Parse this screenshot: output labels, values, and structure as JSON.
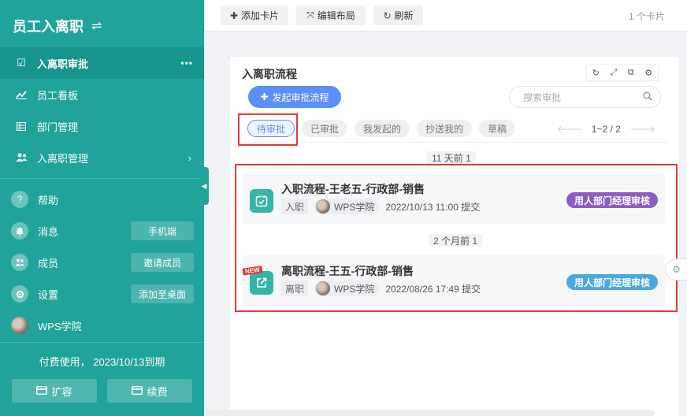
{
  "app": {
    "title": "员工入离职",
    "swap_icon": "swap-icon"
  },
  "sidebar": {
    "nav": [
      {
        "label": "入离职审批",
        "icon": "check-square-icon",
        "active": true,
        "more": "•••"
      },
      {
        "label": "员工看板",
        "icon": "line-chart-icon"
      },
      {
        "label": "部门管理",
        "icon": "table-icon"
      },
      {
        "label": "入离职管理",
        "icon": "users-icon",
        "chevron": "›"
      }
    ],
    "util": [
      {
        "label": "帮助",
        "icon": "question-icon"
      },
      {
        "label": "消息",
        "icon": "bell-icon",
        "action": "手机端"
      },
      {
        "label": "成员",
        "icon": "members-icon",
        "action": "邀请成员"
      },
      {
        "label": "设置",
        "icon": "gear-icon",
        "action": "添加至桌面"
      },
      {
        "label": "WPS学院",
        "icon": "avatar"
      }
    ],
    "expiry": "付费使用， 2023/10/13到期",
    "expand_label": "扩容",
    "renew_label": "续费"
  },
  "toolbar": {
    "add_card": "添加卡片",
    "edit_layout": "编辑布局",
    "refresh": "刷新",
    "card_count": "1 个卡片"
  },
  "card": {
    "title": "入离职流程",
    "start_button": "发起审批流程",
    "search_placeholder": "搜索审批",
    "tabs": [
      "待审批",
      "已审批",
      "我发起的",
      "抄送我的",
      "草稿"
    ],
    "active_tab": 0,
    "pager": "1~2 / 2",
    "groups": [
      {
        "label": "11 天前 1",
        "item": {
          "title": "入职流程-王老五-行政部-销售",
          "type": "入职",
          "user": "WPS学院",
          "time": "2022/10/13 11:00 提交",
          "status": "用人部门经理审核",
          "status_color": "#8e5cc4",
          "icon": "calendar-check-icon",
          "is_new": false
        }
      },
      {
        "label": "2 个月前 1",
        "item": {
          "title": "离职流程-王五-行政部-销售",
          "type": "离职",
          "user": "WPS学院",
          "time": "2022/08/26 17:49 提交",
          "status": "用人部门经理审核",
          "status_color": "#4aa8e0",
          "icon": "external-link-icon",
          "is_new": true,
          "new_label": "NEW"
        }
      }
    ]
  }
}
